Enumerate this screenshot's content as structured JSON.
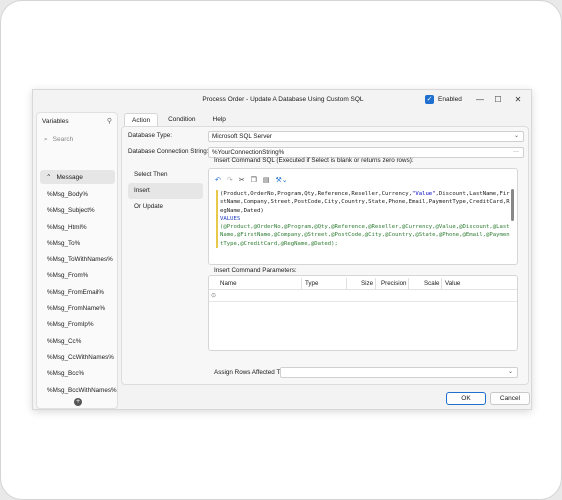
{
  "window": {
    "title": "Process Order - Update A Database Using Custom SQL",
    "enabled_label": "Enabled",
    "minimize": "—",
    "maximize": "☐",
    "close": "✕"
  },
  "variables": {
    "title": "Variables",
    "search_placeholder": "Search",
    "group_label": "Message",
    "items": [
      "%Msg_Body%",
      "%Msg_Subject%",
      "%Msg_Html%",
      "%Msg_To%",
      "%Msg_ToWithNames%",
      "%Msg_From%",
      "%Msg_FromEmail%",
      "%Msg_FromName%",
      "%Msg_FromIp%",
      "%Msg_Cc%",
      "%Msg_CcWithNames%",
      "%Msg_Bcc%",
      "%Msg_BccWithNames%"
    ]
  },
  "tabs": [
    "Action",
    "Condition",
    "Help"
  ],
  "form": {
    "db_type_label": "Database Type:",
    "db_type_value": "Microsoft SQL Server",
    "conn_label": "Database Connection String:",
    "conn_value": "%YourConnectionString%",
    "conn_more": "···"
  },
  "steps": [
    "Select Then",
    "Insert",
    "Or Update"
  ],
  "sql": {
    "label": "Insert Command SQL (Executed if Select is blank or returns zero rows):",
    "toolbar_icons": [
      "undo-icon",
      "redo-icon",
      "cut-icon",
      "copy-icon",
      "paste-icon",
      "insert-variable-icon"
    ],
    "line1_a": "(Product,OrderNo,Program,Qty,Reference,Reseller,Currency,",
    "line1_str": "\"Value\"",
    "line1_b": ",Discount,LastName,FirstName,Company,Street,PostCode,City,Country,State,Phone,Email,PaymentType,CreditCard,RegName,Dated)",
    "keyword": "VALUES",
    "values": "(@Product,@OrderNo,@Program,@Qty,@Reference,@Reseller,@Currency,@Value,@Discount,@LastName,@FirstName,@Company,@Street,@PostCode,@City,@Country,@State,@Phone,@Email,@PaymentType,@CreditCard,@RegName,@Dated);"
  },
  "params": {
    "label": "Insert Command Parameters:",
    "columns": [
      "Name",
      "Type",
      "Size",
      "Precision",
      "Scale",
      "Value"
    ],
    "new_row_marker": "⊙"
  },
  "assign": {
    "label": "Assign Rows Affected To:"
  },
  "buttons": {
    "ok": "OK",
    "cancel": "Cancel"
  },
  "colors": {
    "accent": "#1f6fd1",
    "keyword": "#1f3fbf",
    "string": "#0000c0",
    "variable": "#2e7d32"
  }
}
